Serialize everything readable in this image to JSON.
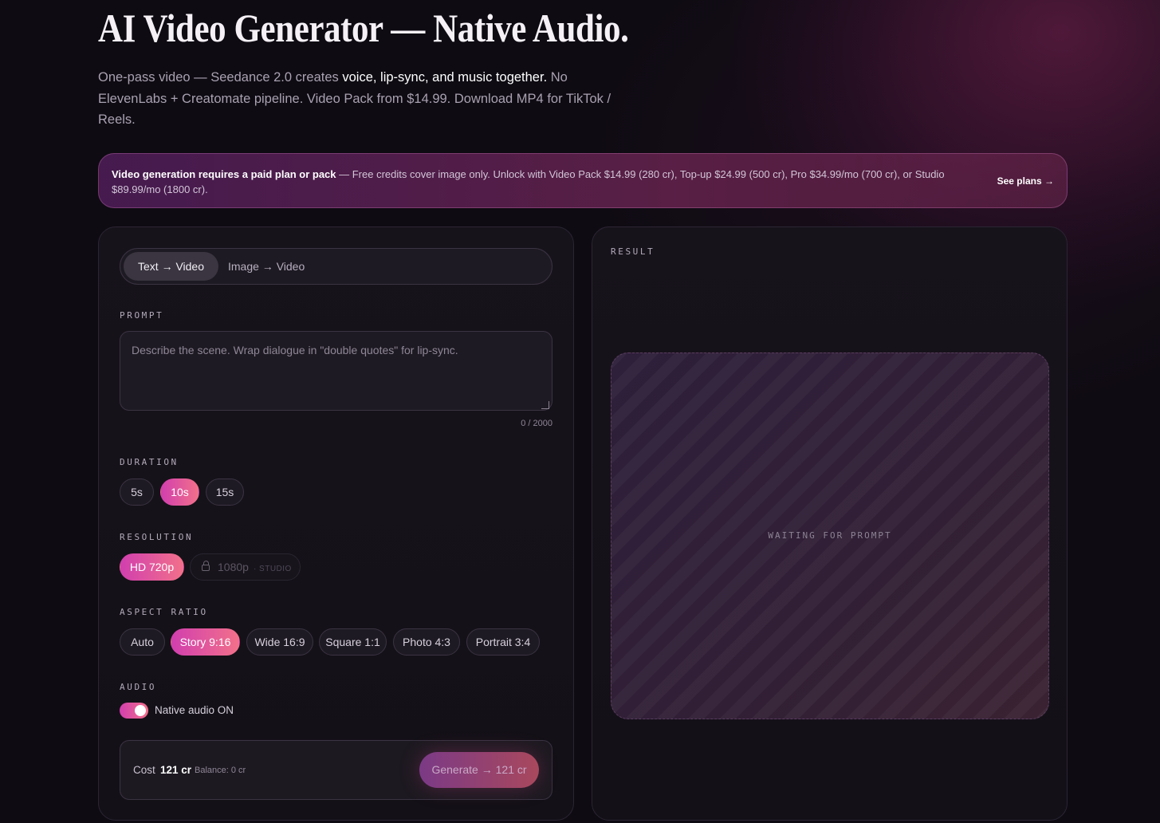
{
  "header": {
    "title": "AI Video Generator — Native Audio.",
    "subtitle_before": "One-pass video — Seedance 2.0 creates ",
    "subtitle_highlight": "voice, lip-sync, and music together.",
    "subtitle_after": " No ElevenLabs + Creatomate pipeline. Video Pack from $14.99. Download MP4 for TikTok / Reels."
  },
  "banner": {
    "bold": "Video generation requires a paid plan or pack",
    "text": " — Free credits cover image only. Unlock with Video Pack $14.99 (280 cr), Top-up $24.99 (500 cr), Pro $34.99/mo (700 cr), or Studio $89.99/mo (1800 cr).",
    "link": "See plans →"
  },
  "tabs": [
    {
      "label": "Text → Video",
      "active": true
    },
    {
      "label": "Image → Video",
      "active": false
    }
  ],
  "prompt": {
    "label": "PROMPT",
    "placeholder": "Describe the scene. Wrap dialogue in \"double quotes\" for lip-sync.",
    "value": "",
    "counter": "0 / 2000"
  },
  "duration": {
    "label": "DURATION",
    "options": [
      "5s",
      "10s",
      "15s"
    ],
    "selected": "10s"
  },
  "resolution": {
    "label": "RESOLUTION",
    "options": [
      {
        "label": "HD 720p",
        "selected": true
      },
      {
        "label": "1080p",
        "locked": true,
        "tier": "· STUDIO"
      }
    ]
  },
  "aspect": {
    "label": "ASPECT RATIO",
    "options": [
      "Auto",
      "Story 9:16",
      "Wide 16:9",
      "Square 1:1",
      "Photo 4:3",
      "Portrait 3:4"
    ],
    "selected": "Story 9:16"
  },
  "audio": {
    "label": "AUDIO",
    "toggle_label": "Native audio ON",
    "enabled": true
  },
  "cost": {
    "label": "Cost",
    "value": "121 cr",
    "balance": "Balance: 0 cr",
    "button": "Generate → 121 cr"
  },
  "result": {
    "label": "RESULT",
    "status": "WAITING FOR PROMPT"
  },
  "colors": {
    "accent_start": "#d13fae",
    "accent_end": "#f2708a",
    "background": "#0e0b12"
  }
}
